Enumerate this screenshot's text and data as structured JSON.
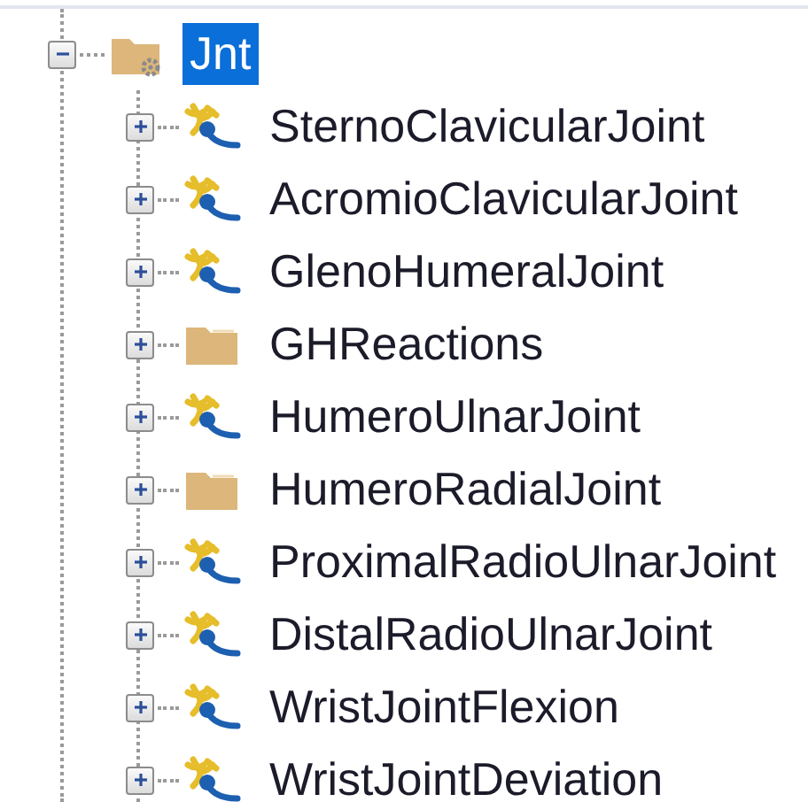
{
  "tree": [
    {
      "label": "Jnt",
      "kind": "settings-folder",
      "expanded": true,
      "selected": true,
      "children": [
        {
          "label": "SternoClavicularJoint",
          "kind": "joint",
          "expanded": false,
          "selected": false
        },
        {
          "label": "AcromioClavicularJoint",
          "kind": "joint",
          "expanded": false,
          "selected": false
        },
        {
          "label": "GlenoHumeralJoint",
          "kind": "joint",
          "expanded": false,
          "selected": false
        },
        {
          "label": "GHReactions",
          "kind": "folder",
          "expanded": false,
          "selected": false
        },
        {
          "label": "HumeroUlnarJoint",
          "kind": "joint",
          "expanded": false,
          "selected": false
        },
        {
          "label": "HumeroRadialJoint",
          "kind": "folder",
          "expanded": false,
          "selected": false
        },
        {
          "label": "ProximalRadioUlnarJoint",
          "kind": "joint",
          "expanded": false,
          "selected": false
        },
        {
          "label": "DistalRadioUlnarJoint",
          "kind": "joint",
          "expanded": false,
          "selected": false
        },
        {
          "label": "WristJointFlexion",
          "kind": "joint",
          "expanded": false,
          "selected": false
        },
        {
          "label": "WristJointDeviation",
          "kind": "joint",
          "expanded": false,
          "selected": false
        }
      ]
    }
  ]
}
